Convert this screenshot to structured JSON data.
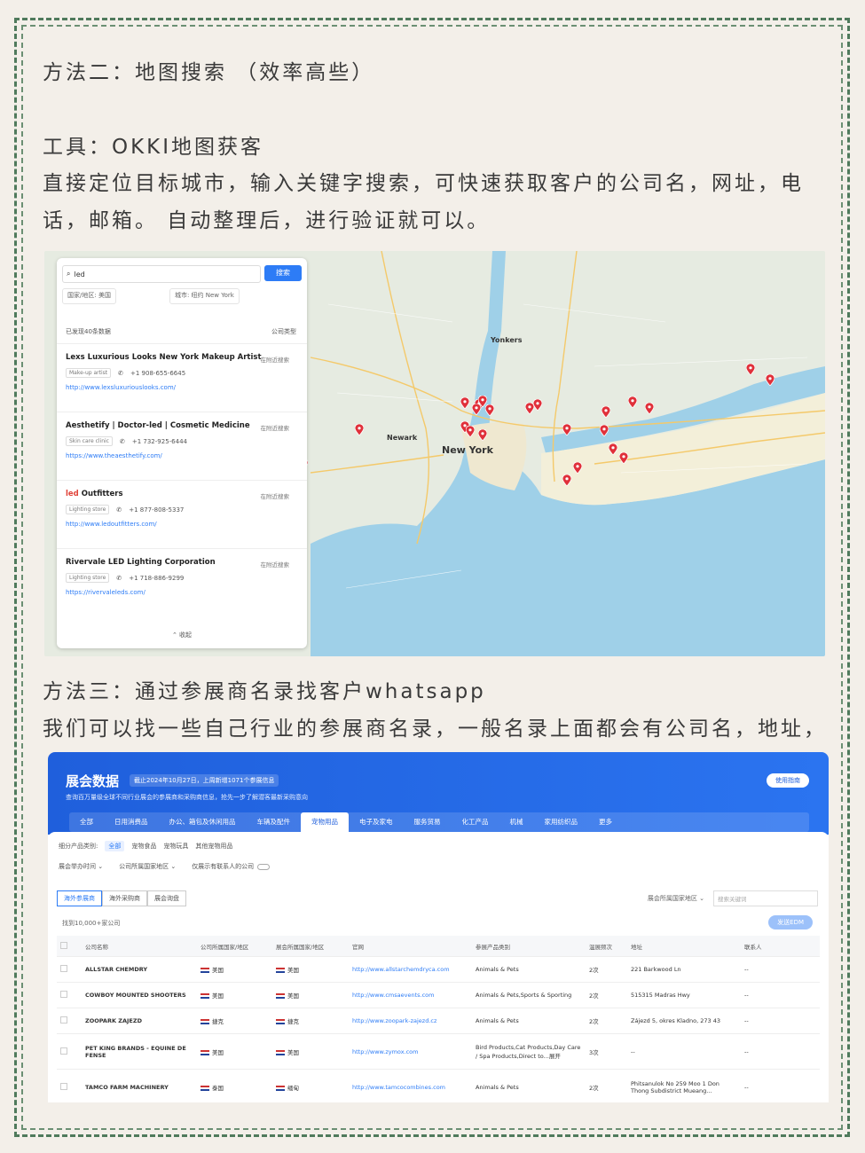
{
  "heading_method2": "方法二：地图搜索 （效率高些）",
  "tool_line": "工具：OKKI地图获客",
  "method2_desc": "直接定位目标城市，输入关键字搜索，可快速获取客户的公司名，网址，电话，邮箱。 自动整理后，进行验证就可以。",
  "heading_method3": "方法三：通过参展商名录找客户whatsapp",
  "method3_desc": "我们可以找一些自己行业的参展商名录，一般名录上面都会有公司名，地址，",
  "map": {
    "search_value": "led",
    "search_button": "搜索",
    "filter_country": "国家/地区: 美国",
    "filter_city": "城市: 纽约 New York",
    "found_count": "已发现40条数据",
    "company_type": "公司类型",
    "collapse": "收起",
    "city_new_york": "New York",
    "city_newark": "Newark",
    "city_yonkers": "Yonkers",
    "results": [
      {
        "title": "Lexs Luxurious Looks New York Makeup Artist",
        "date": "在附近搜索",
        "tag": "Make-up artist",
        "phone": "+1 908-655-6645",
        "url": "http://www.lexsluxuriouslooks.com/"
      },
      {
        "title": "Aesthetify | Doctor-led | Cosmetic Medicine",
        "date": "在附近搜索",
        "tag": "Skin care clinic",
        "phone": "+1 732-925-6444",
        "url": "https://www.theaesthetify.com/"
      },
      {
        "title_hl": "led",
        "title": " Outfitters",
        "date": "在附近搜索",
        "tag": "Lighting store",
        "phone": "+1 877-808-5337",
        "url": "http://www.ledoutfitters.com/"
      },
      {
        "title": "Rivervale LED Lighting Corporation",
        "date": "在附近搜索",
        "tag": "Lighting store",
        "phone": "+1 718-886-9299",
        "url": "https://rivervaleleds.com/"
      }
    ]
  },
  "expo": {
    "title": "展会数据",
    "badge": "截止2024年10月27日，上周新增1071个参展信息",
    "subtitle": "查询百万量级全球不同行业展会的参展商和采购商信息，抢先一步了解潜客最新采购意向",
    "guide": "使用指南",
    "tabs": [
      "全部",
      "日用消费品",
      "办公、箱包及休闲用品",
      "车辆及配件",
      "宠物用品",
      "电子及家电",
      "服务贸易",
      "化工产品",
      "机械",
      "家用纺织品",
      "更多"
    ],
    "active_tab": "宠物用品",
    "sub_label": "细分产品类别:",
    "sub_cats": [
      "全部",
      "宠物食品",
      "宠物玩具",
      "其他宠物用品"
    ],
    "filter_time": "展会举办时间",
    "filter_country": "公司所属国家地区",
    "filter_contact": "仅展示有联系人的公司",
    "seg_tabs": [
      "海外参展商",
      "海外采购商",
      "展会询盘"
    ],
    "right_country": "展会所属国家地区",
    "keyword_placeholder": "搜索关键词",
    "found": "找到10,000+家公司",
    "edm": "发送EDM",
    "columns": [
      "公司名称",
      "公司所属国家/地区",
      "展会所属国家/地区",
      "官网",
      "参展产品类别",
      "温展频次",
      "地址",
      "联系人"
    ],
    "rows": [
      {
        "name": "ALLSTAR CHEMDRY",
        "country": "美国",
        "expo_country": "美国",
        "site": "http://www.allstarchemdryca.com",
        "category": "Animals & Pets",
        "freq": "2次",
        "address": "221 Barkwood Ln",
        "contact": "--"
      },
      {
        "name": "COWBOY MOUNTED SHOOTERS",
        "country": "美国",
        "expo_country": "美国",
        "site": "http://www.cmsaevents.com",
        "category": "Animals & Pets,Sports & Sporting",
        "freq": "2次",
        "address": "515315 Madras Hwy",
        "contact": "--"
      },
      {
        "name": "ZOOPARK ZAJEZD",
        "country": "捷克",
        "expo_country": "捷克",
        "site": "http://www.zoopark-zajezd.cz",
        "category": "Animals & Pets",
        "freq": "2次",
        "address": "Zájezd 5, okres Kladno, 273 43",
        "contact": "--"
      },
      {
        "name": "PET KING BRANDS - EQUINE DE FENSE",
        "country": "美国",
        "expo_country": "美国",
        "site": "http://www.zymox.com",
        "category": "Bird Products,Cat Products,Day Care / Spa Products,Direct to...展开",
        "freq": "3次",
        "address": "--",
        "contact": "--"
      },
      {
        "name": "TAMCO FARM MACHINERY",
        "country": "泰国",
        "expo_country": "缅甸",
        "site": "http://www.tamcocombines.com",
        "category": "Animals & Pets",
        "freq": "2次",
        "address": "Phitsanulok No 259 Moo 1 Don Thong Subdistrict Mueang...",
        "contact": "--"
      }
    ]
  },
  "colors": {
    "frame": "#4f7a5c",
    "accent": "#2d7cf6",
    "pin": "#e0303a"
  }
}
